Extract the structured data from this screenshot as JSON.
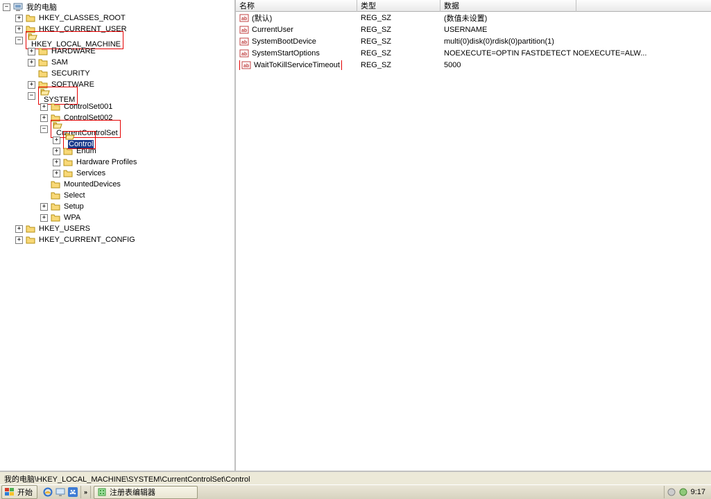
{
  "tree": {
    "root_label": "我的电脑",
    "hkcr": "HKEY_CLASSES_ROOT",
    "hkcu": "HKEY_CURRENT_USER",
    "hklm": "HKEY_LOCAL_MACHINE",
    "hardware": "HARDWARE",
    "sam": "SAM",
    "security": "SECURITY",
    "software": "SOFTWARE",
    "system": "SYSTEM",
    "cs001": "ControlSet001",
    "cs002": "ControlSet002",
    "ccs": "CurrentControlSet",
    "control": "Control",
    "enum": "Enum",
    "hwprofiles": "Hardware Profiles",
    "services": "Services",
    "mounted": "MountedDevices",
    "select": "Select",
    "setup": "Setup",
    "wpa": "WPA",
    "hku": "HKEY_USERS",
    "hkcc": "HKEY_CURRENT_CONFIG"
  },
  "list": {
    "headers": {
      "name": "名称",
      "type": "类型",
      "data": "数据"
    },
    "rows": [
      {
        "name": "(默认)",
        "type": "REG_SZ",
        "data": "(数值未设置)",
        "highlighted": false
      },
      {
        "name": "CurrentUser",
        "type": "REG_SZ",
        "data": "USERNAME",
        "highlighted": false
      },
      {
        "name": "SystemBootDevice",
        "type": "REG_SZ",
        "data": "multi(0)disk(0)rdisk(0)partition(1)",
        "highlighted": false
      },
      {
        "name": "SystemStartOptions",
        "type": "REG_SZ",
        "data": "NOEXECUTE=OPTIN  FASTDETECT  NOEXECUTE=ALW...",
        "highlighted": false
      },
      {
        "name": "WaitToKillServiceTimeout",
        "type": "REG_SZ",
        "data": "5000",
        "highlighted": true
      }
    ]
  },
  "status_path": "我的电脑\\HKEY_LOCAL_MACHINE\\SYSTEM\\CurrentControlSet\\Control",
  "taskbar": {
    "start": "开始",
    "app_title": "注册表编辑器",
    "clock": "9:17"
  }
}
